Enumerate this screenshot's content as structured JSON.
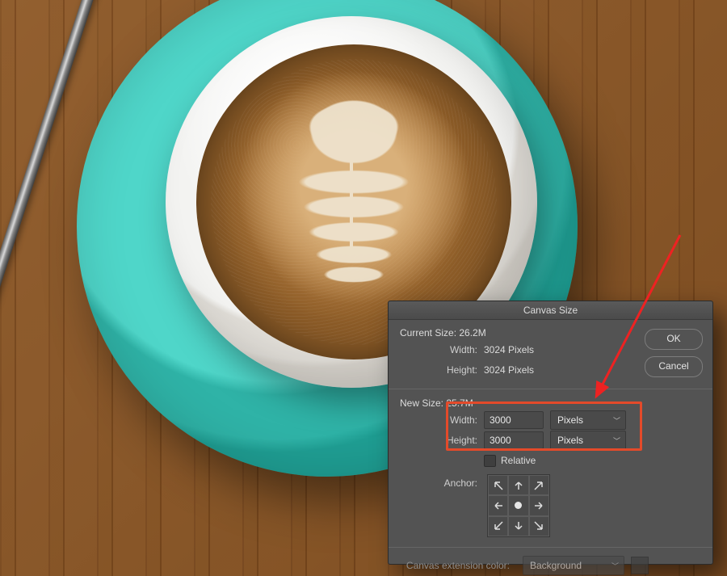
{
  "dialog": {
    "title": "Canvas Size",
    "current": {
      "heading": "Current Size: 26.2M",
      "width_label": "Width:",
      "width_value": "3024 Pixels",
      "height_label": "Height:",
      "height_value": "3024 Pixels"
    },
    "newsize": {
      "heading": "New Size: 25.7M",
      "width_label": "Width:",
      "width_value": "3000",
      "width_unit": "Pixels",
      "height_label": "Height:",
      "height_value": "3000",
      "height_unit": "Pixels",
      "relative_label": "Relative",
      "anchor_label": "Anchor:"
    },
    "extension": {
      "label": "Canvas extension color:",
      "value": "Background"
    },
    "buttons": {
      "ok": "OK",
      "cancel": "Cancel"
    }
  }
}
